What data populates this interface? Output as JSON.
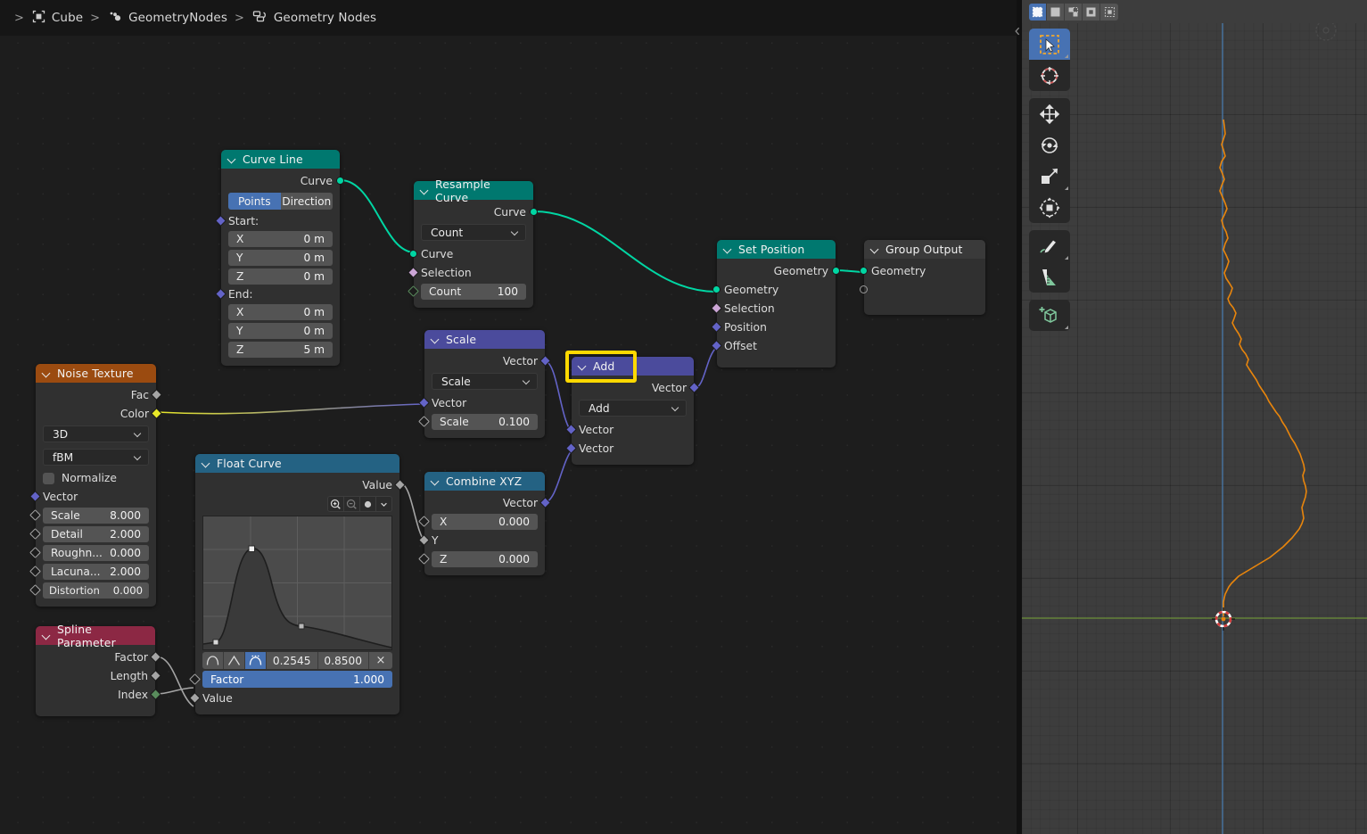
{
  "breadcrumb": {
    "items": [
      {
        "icon": "object-icon",
        "label": "Cube"
      },
      {
        "icon": "modifier-icon",
        "label": "GeometryNodes"
      },
      {
        "icon": "nodetree-icon",
        "label": "Geometry Nodes"
      }
    ],
    "separator": ">"
  },
  "nodes": {
    "curve_line": {
      "title": "Curve Line",
      "outputs": [
        {
          "label": "Curve",
          "type": "geometry"
        }
      ],
      "mode_toggle": {
        "options": [
          "Points",
          "Direction"
        ],
        "selected": "Points"
      },
      "start_label": "Start:",
      "start": [
        {
          "label": "X",
          "value": "0 m"
        },
        {
          "label": "Y",
          "value": "0 m"
        },
        {
          "label": "Z",
          "value": "0 m"
        }
      ],
      "end_label": "End:",
      "end": [
        {
          "label": "X",
          "value": "0 m"
        },
        {
          "label": "Y",
          "value": "0 m"
        },
        {
          "label": "Z",
          "value": "5 m"
        }
      ]
    },
    "resample_curve": {
      "title": "Resample Curve",
      "outputs": [
        {
          "label": "Curve"
        }
      ],
      "mode": "Count",
      "inputs": [
        {
          "label": "Curve",
          "type": "geometry"
        },
        {
          "label": "Selection",
          "type": "boolean"
        }
      ],
      "count": {
        "label": "Count",
        "value": "100"
      }
    },
    "set_position": {
      "title": "Set Position",
      "outputs": [
        {
          "label": "Geometry"
        }
      ],
      "inputs": [
        {
          "label": "Geometry",
          "type": "geometry"
        },
        {
          "label": "Selection",
          "type": "boolean"
        },
        {
          "label": "Position",
          "type": "vector"
        },
        {
          "label": "Offset",
          "type": "vector"
        }
      ]
    },
    "group_output": {
      "title": "Group Output",
      "inputs": [
        {
          "label": "Geometry",
          "type": "geometry"
        },
        {
          "label": "",
          "type": "virtual"
        }
      ]
    },
    "scale": {
      "title": "Scale",
      "outputs": [
        {
          "label": "Vector"
        }
      ],
      "operation": "Scale",
      "inputs": [
        {
          "label": "Vector",
          "type": "vector"
        }
      ],
      "scale_field": {
        "label": "Scale",
        "value": "0.100"
      }
    },
    "add": {
      "title": "Add",
      "outputs": [
        {
          "label": "Vector"
        }
      ],
      "operation": "Add",
      "inputs": [
        {
          "label": "Vector",
          "type": "vector"
        },
        {
          "label": "Vector",
          "type": "vector"
        }
      ],
      "highlighted": true
    },
    "noise_texture": {
      "title": "Noise Texture",
      "outputs": [
        {
          "label": "Fac",
          "type": "float"
        },
        {
          "label": "Color",
          "type": "color"
        }
      ],
      "dimensions": "3D",
      "noise_type": "fBM",
      "normalize": {
        "label": "Normalize",
        "checked": false
      },
      "vector_label": "Vector",
      "fields": [
        {
          "label": "Scale",
          "value": "8.000"
        },
        {
          "label": "Detail",
          "value": "2.000"
        },
        {
          "label": "Roughn...",
          "value": "0.000"
        },
        {
          "label": "Lacuna...",
          "value": "2.000"
        },
        {
          "label": "Distortion",
          "value": "0.000"
        }
      ]
    },
    "spline_parameter": {
      "title": "Spline Parameter",
      "outputs": [
        {
          "label": "Factor",
          "type": "float"
        },
        {
          "label": "Length",
          "type": "float"
        },
        {
          "label": "Index",
          "type": "int"
        }
      ]
    },
    "float_curve": {
      "title": "Float Curve",
      "outputs": [
        {
          "label": "Value",
          "type": "float"
        }
      ],
      "tools": [
        "zoom-in-icon",
        "zoom-out-icon",
        "curve-tools-icon",
        "dropdown-icon"
      ],
      "handle_types": [
        "auto-handle-icon",
        "vector-handle-icon",
        "auto-clamped-handle-icon"
      ],
      "handle_selected": "auto-clamped-handle-icon",
      "point_x": "0.2545",
      "point_y": "0.8500",
      "delete_label": "×",
      "factor": {
        "label": "Factor",
        "value": "1.000"
      },
      "value_input_label": "Value"
    },
    "combine_xyz": {
      "title": "Combine XYZ",
      "outputs": [
        {
          "label": "Vector",
          "type": "vector"
        }
      ],
      "fields": [
        {
          "label": "X",
          "value": "0.000",
          "kind": "field"
        },
        {
          "label": "Y",
          "value": "",
          "kind": "linked"
        },
        {
          "label": "Z",
          "value": "0.000",
          "kind": "field"
        }
      ]
    }
  },
  "viewport": {
    "select_modes": [
      "select-set-icon",
      "select-extend-icon",
      "select-subtract-icon",
      "select-invert-icon",
      "select-intersect-icon"
    ],
    "select_mode_active": "select-set-icon",
    "toolbar": [
      {
        "name": "tweak-select-box-tool",
        "active": true
      },
      {
        "name": "cursor-tool",
        "active": false
      },
      {
        "name": "move-tool",
        "active": false
      },
      {
        "name": "rotate-tool",
        "active": false
      },
      {
        "name": "scale-tool",
        "active": false
      },
      {
        "name": "transform-tool",
        "active": false
      },
      {
        "name": "annotate-tool",
        "active": false
      },
      {
        "name": "measure-tool",
        "active": false
      },
      {
        "name": "add-cube-tool",
        "active": false
      }
    ],
    "curve_color": "#e8850c",
    "z_axis_color": "#4a7fb5",
    "x_axis_color": "#6b8f3a"
  },
  "colors": {
    "header_geometry": "#00786f",
    "header_vector": "#4b4b9c",
    "header_texture": "#9b4b10",
    "header_input": "#8c2844",
    "header_converter": "#246283",
    "header_output": "#3a3a3a",
    "accent_blue": "#4772b3",
    "highlight": "#ffd900",
    "socket_geometry": "#00d6a3",
    "socket_vector": "#6363c7",
    "socket_float": "#a1a1a1",
    "socket_color": "#e8e828",
    "socket_boolean": "#cca6d6",
    "socket_int": "#598c5c"
  }
}
